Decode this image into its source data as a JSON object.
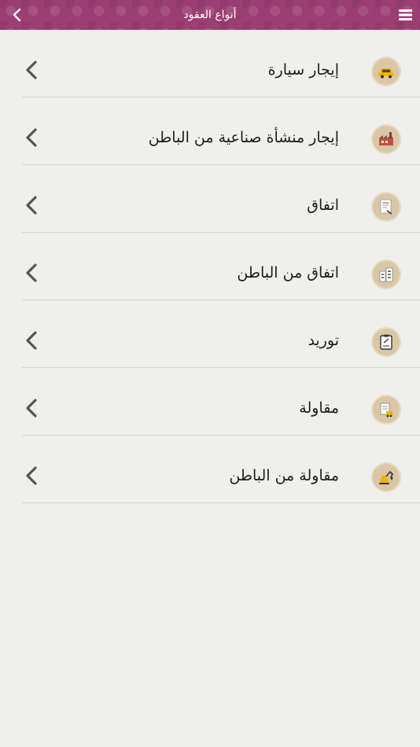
{
  "header": {
    "title": "أنواع العقود",
    "back_icon": "chevron-left-icon",
    "menu_icon": "hamburger-menu-icon",
    "color": "#9b3e72"
  },
  "contract_types": [
    {
      "label": "إيجار سيارة",
      "icon": "car-icon"
    },
    {
      "label": "إيجار منشأة صناعية من الباطن",
      "icon": "factory-icon"
    },
    {
      "label": "اتفاق",
      "icon": "agreement-document-icon"
    },
    {
      "label": "اتفاق من الباطن",
      "icon": "buildings-icon"
    },
    {
      "label": "توريد",
      "icon": "clipboard-icon"
    },
    {
      "label": "مقاولة",
      "icon": "contract-building-icon"
    },
    {
      "label": "مقاولة من الباطن",
      "icon": "excavator-icon"
    }
  ],
  "colors": {
    "background": "#efefed",
    "divider": "#d6d6d3",
    "chevron": "#555555",
    "icon_circle": "#d9c7a5"
  }
}
